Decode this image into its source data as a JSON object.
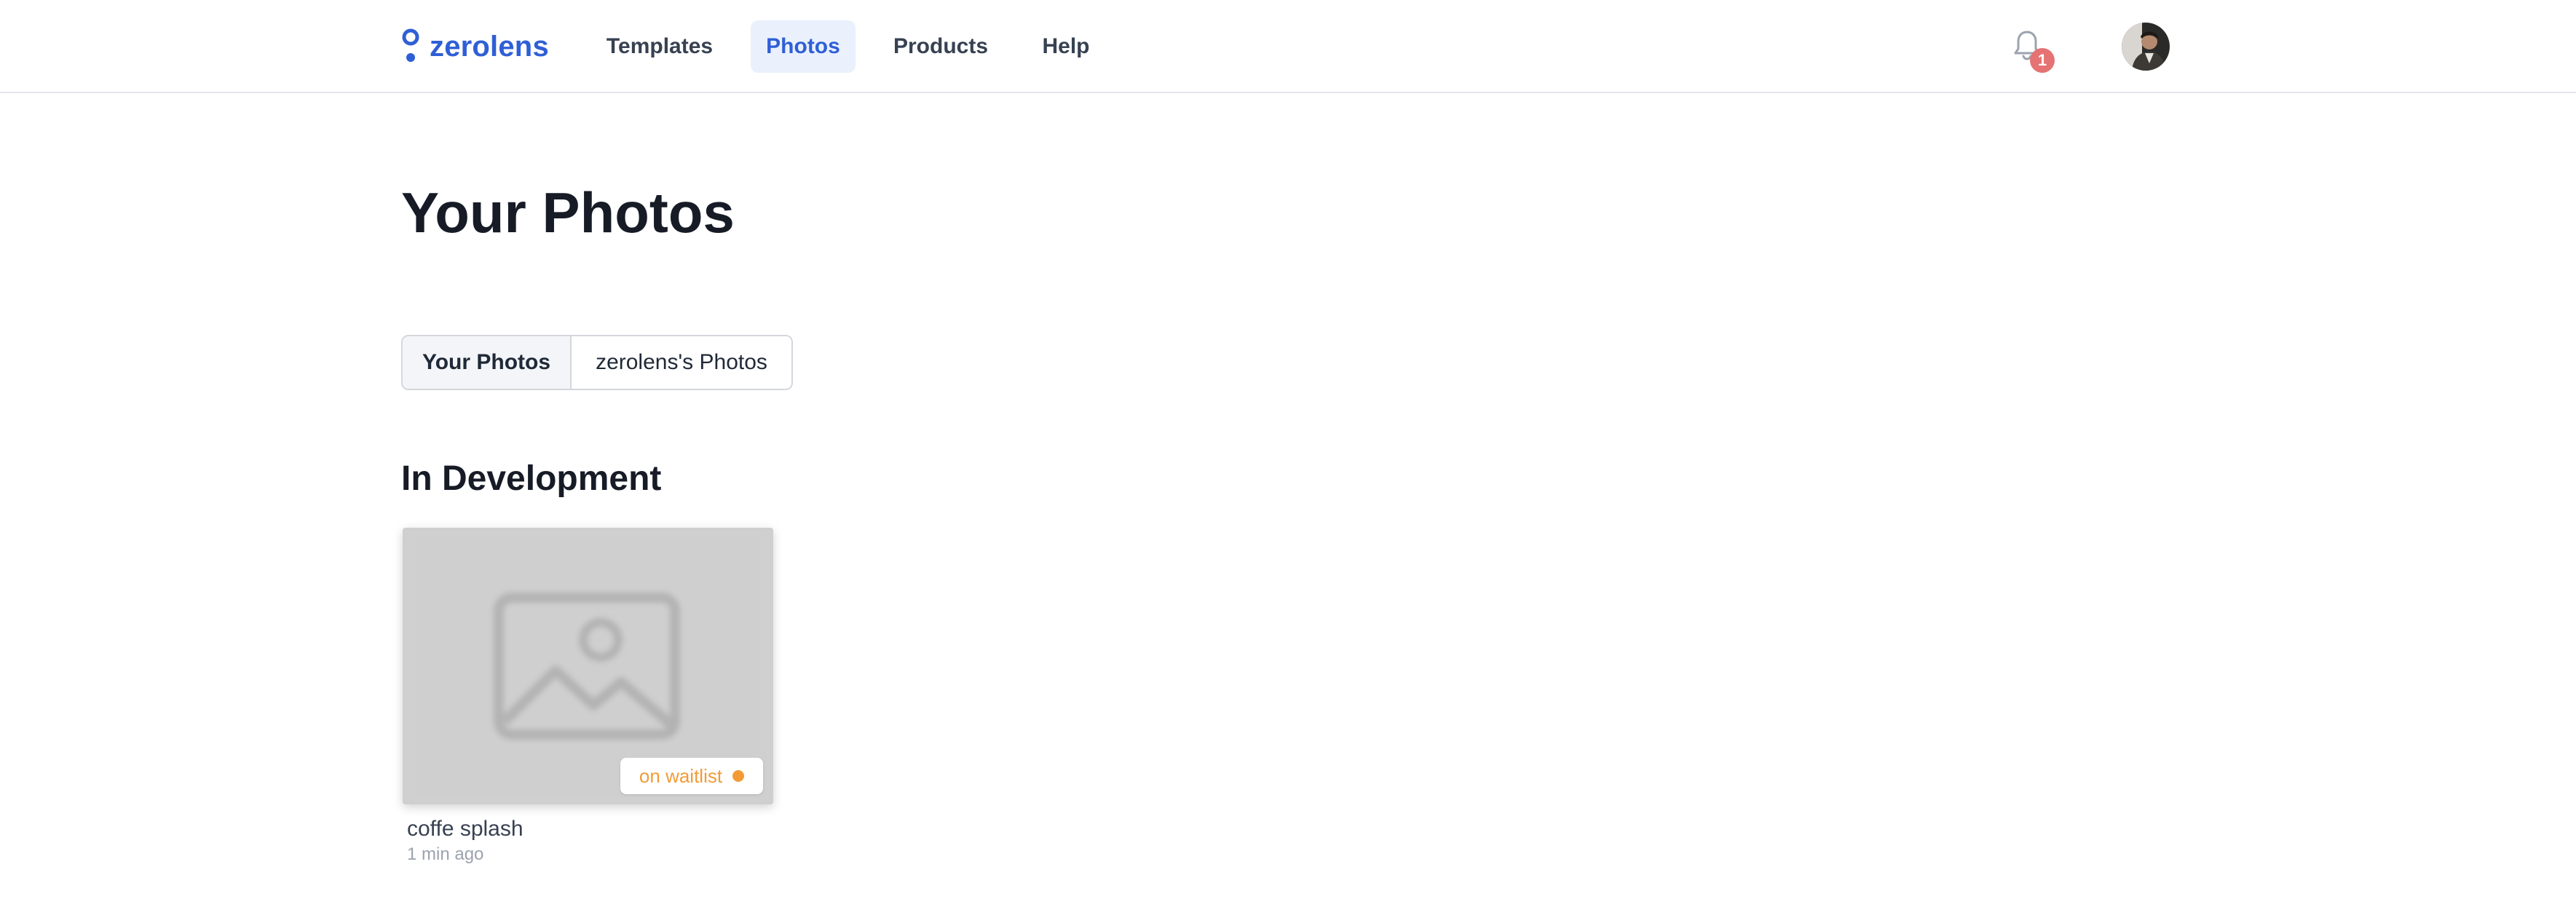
{
  "app": {
    "logo_text": "zerolens",
    "brand_color": "#2f5fd6"
  },
  "nav": {
    "items": [
      {
        "label": "Templates",
        "active": false
      },
      {
        "label": "Photos",
        "active": true
      },
      {
        "label": "Products",
        "active": false
      },
      {
        "label": "Help",
        "active": false
      }
    ]
  },
  "notifications": {
    "icon": "bell-icon",
    "count": "1",
    "badge_color": "#e57373"
  },
  "page": {
    "title": "Your Photos"
  },
  "toggle": {
    "options": [
      {
        "label": "Your Photos",
        "active": true
      },
      {
        "label": "zerolens's Photos",
        "active": false
      }
    ]
  },
  "sections": [
    {
      "title": "In Development",
      "items": [
        {
          "title": "coffe splash",
          "time": "1 min ago",
          "status": "on waitlist",
          "status_color": "#f29b36",
          "thumbnail_icon": "image-placeholder-icon"
        }
      ]
    }
  ]
}
